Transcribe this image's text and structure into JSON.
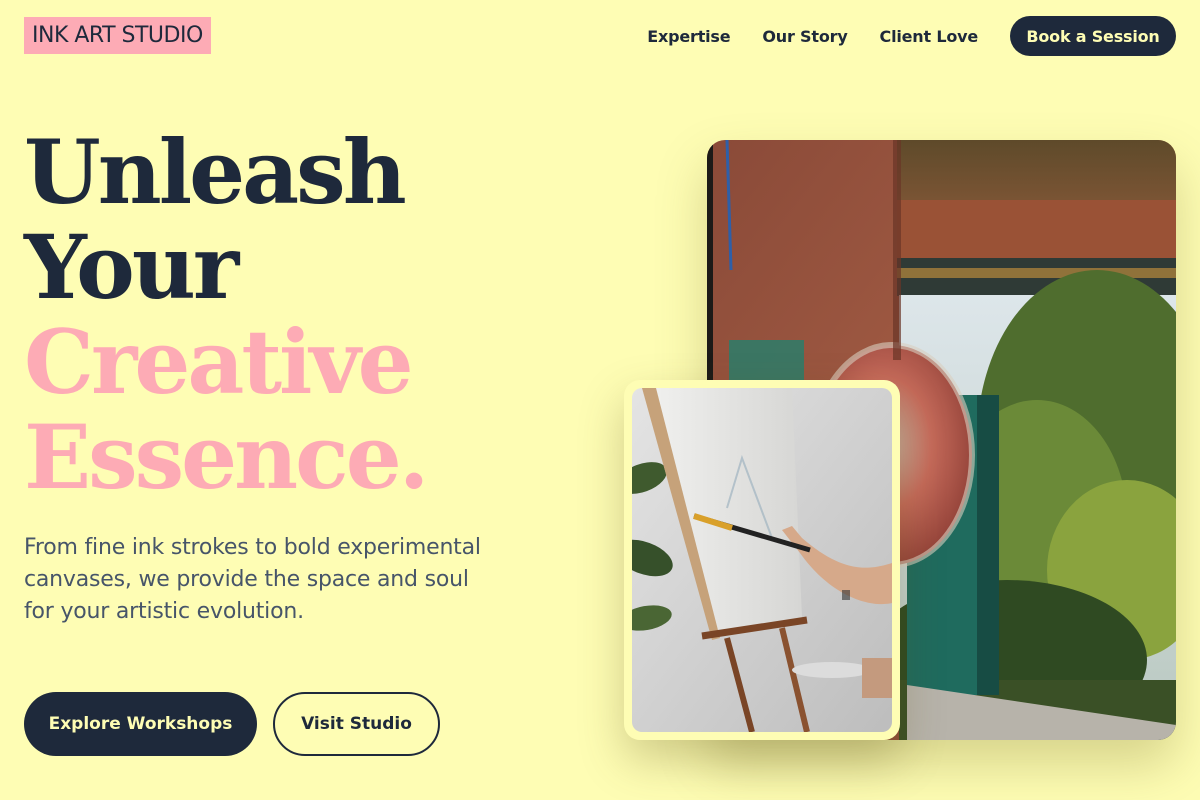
{
  "brand": {
    "logo_text": "INK ART STUDIO"
  },
  "nav": {
    "links": [
      "Expertise",
      "Our Story",
      "Client Love"
    ],
    "cta_label": "Book a Session"
  },
  "hero": {
    "headline_lines": [
      "Unleash",
      "Your",
      "Creative",
      "Essence."
    ],
    "subtext": "From fine ink strokes to bold experimental canvases, we provide the space and soul for your artistic evolution.",
    "primary_button": "Explore Workshops",
    "secondary_button": "Visit Studio"
  },
  "images": {
    "main_photo": "studio-window-photo",
    "inset_photo": "painting-at-easel-photo"
  },
  "colors": {
    "background": "#fefdb4",
    "navy": "#1e293b",
    "pink": "#fdabb5",
    "body_text": "#475569"
  }
}
